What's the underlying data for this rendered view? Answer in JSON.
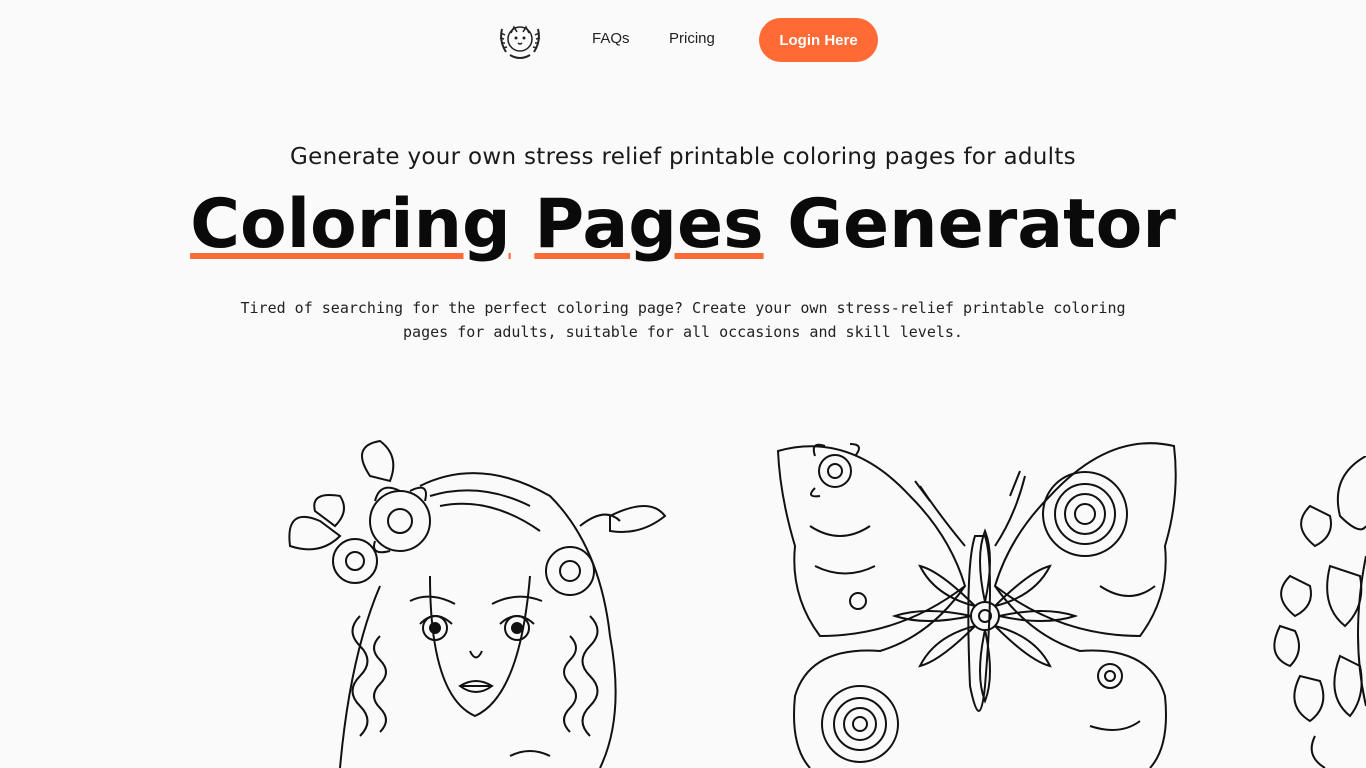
{
  "nav": {
    "logo_icon": "dog-wreath-logo-icon",
    "faqs_label": "FAQs",
    "pricing_label": "Pricing",
    "login_label": "Login Here"
  },
  "hero": {
    "subtitle": "Generate your own stress relief printable coloring pages for adults",
    "title_part1": "Coloring",
    "title_part2": "Pages",
    "title_part3": "Generator",
    "description": "Tired of searching for the perfect coloring page? Create your own stress-relief printable coloring pages for adults, suitable for all occasions and skill levels."
  },
  "colors": {
    "accent": "#ff6a35",
    "background": "#fafafa",
    "text": "#111111"
  }
}
